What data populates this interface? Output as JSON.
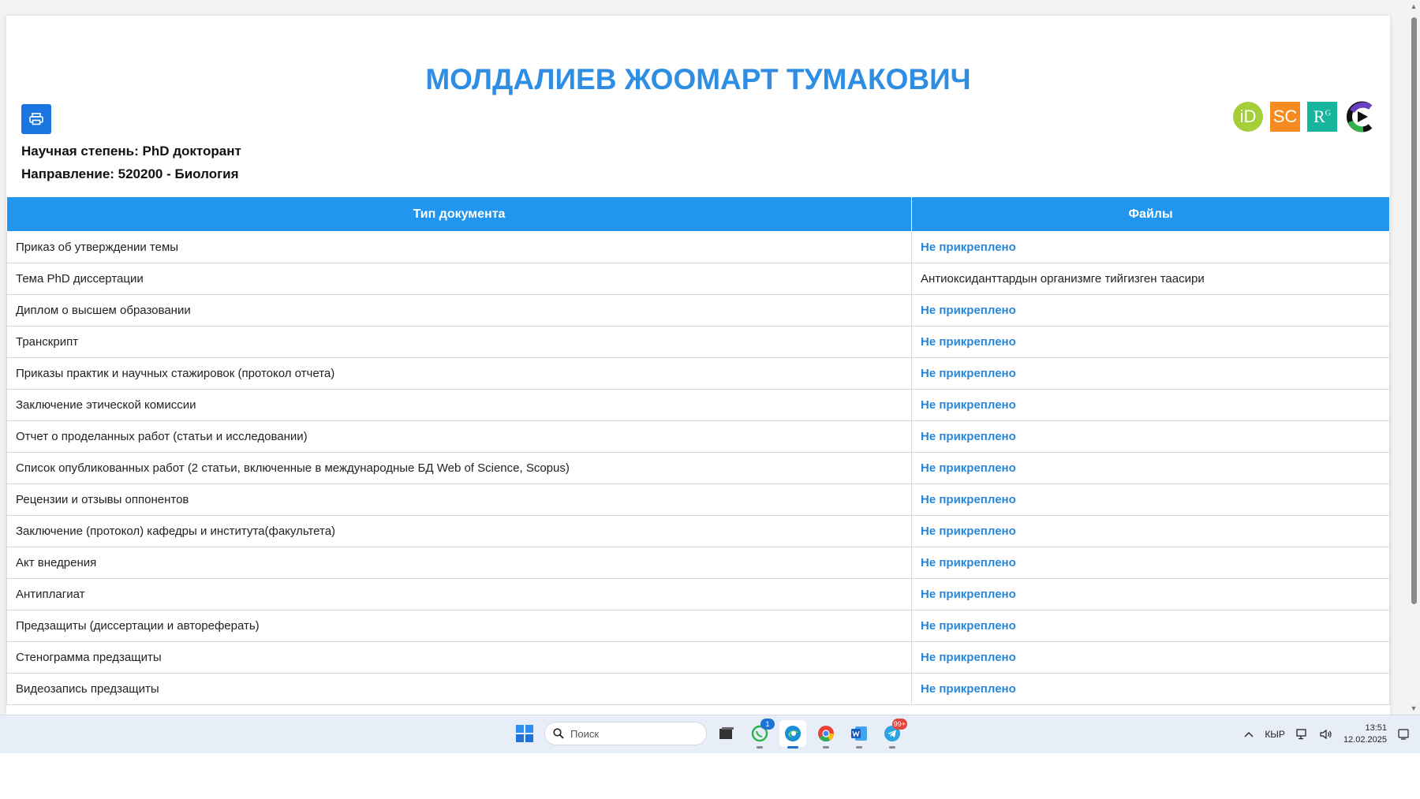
{
  "page": {
    "title": "МОЛДАЛИЕВ ЖООМАРТ ТУМАКОВИЧ",
    "degree": "Научная степень: PhD докторант",
    "direction": "Направление: 520200 - Биология",
    "print_icon": "printer-icon",
    "profiles": [
      {
        "name": "orcid",
        "label": "iD"
      },
      {
        "name": "scopus",
        "label": "SC"
      },
      {
        "name": "researchgate",
        "label": "R"
      },
      {
        "name": "google-scholar",
        "label": ""
      }
    ]
  },
  "table": {
    "headers": [
      "Тип документа",
      "Файлы"
    ],
    "rows": [
      {
        "type": "Приказ об утверждении темы",
        "file": "Не прикреплено",
        "missing": true
      },
      {
        "type": "Тема PhD диссертации",
        "file": "Антиоксиданттардын организмге тийгизген таасири",
        "missing": false
      },
      {
        "type": "Диплом о высшем образовании",
        "file": "Не прикреплено",
        "missing": true
      },
      {
        "type": "Транскрипт",
        "file": "Не прикреплено",
        "missing": true
      },
      {
        "type": "Приказы практик и научных стажировок (протокол отчета)",
        "file": "Не прикреплено",
        "missing": true
      },
      {
        "type": "Заключение этической комиссии",
        "file": "Не прикреплено",
        "missing": true
      },
      {
        "type": "Отчет о проделанных работ (статьи и исследовании)",
        "file": "Не прикреплено",
        "missing": true
      },
      {
        "type": "Список опубликованных работ (2 статьи, включенные в международные БД Web of Science, Scopus)",
        "file": "Не прикреплено",
        "missing": true
      },
      {
        "type": "Рецензии и отзывы оппонентов",
        "file": "Не прикреплено",
        "missing": true
      },
      {
        "type": "Заключение (протокол) кафедры и института(факультета)",
        "file": "Не прикреплено",
        "missing": true
      },
      {
        "type": "Акт внедрения",
        "file": "Не прикреплено",
        "missing": true
      },
      {
        "type": "Антиплагиат",
        "file": "Не прикреплено",
        "missing": true
      },
      {
        "type": "Предзащиты (диссертации и автореферать)",
        "file": "Не прикреплено",
        "missing": true
      },
      {
        "type": "Стенограмма предзащиты",
        "file": "Не прикреплено",
        "missing": true
      },
      {
        "type": "Видеозапись предзащиты",
        "file": "Не прикреплено",
        "missing": true
      }
    ]
  },
  "taskbar": {
    "search_placeholder": "Поиск",
    "apps": [
      {
        "name": "start-icon",
        "badge": ""
      },
      {
        "name": "search",
        "badge": ""
      },
      {
        "name": "task-view-icon",
        "badge": ""
      },
      {
        "name": "whatsapp-icon",
        "badge": "1"
      },
      {
        "name": "edge-icon",
        "badge": ""
      },
      {
        "name": "chrome-icon",
        "badge": ""
      },
      {
        "name": "word-icon",
        "badge": ""
      },
      {
        "name": "telegram-icon",
        "badge": "99+"
      }
    ],
    "language": "КЫР",
    "time": "13:51",
    "date": "12.02.2025"
  },
  "colors": {
    "title": "#2d8ee3",
    "header_bg": "#2295ee",
    "missing_link": "#2886d6",
    "print_button": "#1976e0"
  }
}
